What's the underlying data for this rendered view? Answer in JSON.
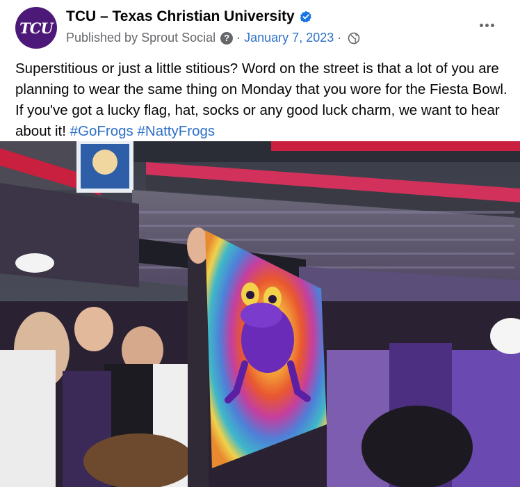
{
  "post": {
    "avatar_text": "TCU",
    "page_name": "TCU – Texas Christian University",
    "publisher": "Published by Sprout Social",
    "help_glyph": "?",
    "separator": "·",
    "date": "January 7, 2023",
    "caption_text": "Superstitious or just a little stitious? Word on the street is that a lot of you are planning to wear the same thing on Monday that you wore for the Fiesta Bowl. If you've got a lucky flag, hat, socks or any good luck charm, we want to hear about it! ",
    "hashtags": [
      "#GoFrogs",
      "#NattyFrogs"
    ]
  },
  "icons": {
    "verified": "verified-badge-icon",
    "help": "help-icon",
    "audience": "globe-icon",
    "more": "more-options-icon"
  },
  "colors": {
    "brand_purple": "#4d1979",
    "link_blue": "#2d70c7",
    "meta_gray": "#65676b",
    "verified_blue": "#1b74e4"
  }
}
